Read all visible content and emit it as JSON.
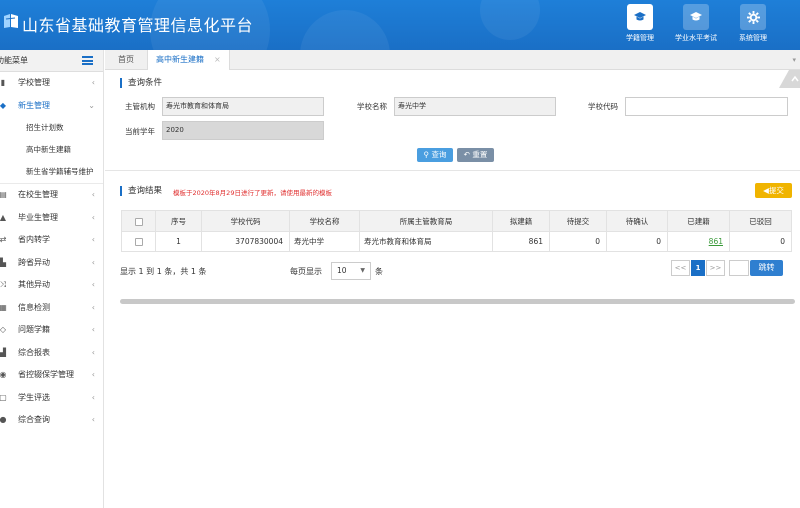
{
  "app": {
    "title": "山东省基础教育管理信息化平台"
  },
  "topnav": [
    {
      "label": "学籍管理",
      "icon": "graduation-cap-icon",
      "active": true
    },
    {
      "label": "学业水平考试",
      "icon": "graduation-cap-icon",
      "active": false
    },
    {
      "label": "系统管理",
      "icon": "gear-icon",
      "active": false
    }
  ],
  "sidebar": {
    "title": "功能菜单",
    "items": [
      {
        "label": "学校管理",
        "icon": "building-icon"
      },
      {
        "label": "新生管理",
        "icon": "user-plus-icon",
        "active": true,
        "expanded": true,
        "sub": [
          "招生计划数",
          "高中新生建籍",
          "新生省学籍辅号维护"
        ]
      },
      {
        "label": "在校生管理",
        "icon": "list-icon"
      },
      {
        "label": "毕业生管理",
        "icon": "graduation-cap-icon"
      },
      {
        "label": "省内转学",
        "icon": "exchange-icon"
      },
      {
        "label": "跨省异动",
        "icon": "map-icon"
      },
      {
        "label": "其他异动",
        "icon": "shuffle-icon"
      },
      {
        "label": "信息检测",
        "icon": "grid-icon"
      },
      {
        "label": "问题学籍",
        "icon": "question-icon"
      },
      {
        "label": "综合报表",
        "icon": "chart-icon"
      },
      {
        "label": "省控辍保学管理",
        "icon": "shield-icon"
      },
      {
        "label": "学生评选",
        "icon": "calendar-icon"
      },
      {
        "label": "综合查询",
        "icon": "search-icon"
      }
    ]
  },
  "tabs": {
    "home": "首页",
    "current": "高中新生建籍",
    "close": "×"
  },
  "query": {
    "section_title": "查询条件",
    "org_label": "主管机构",
    "org_value": "寿光市教育和体育局",
    "school_label": "学校名称",
    "school_value": "寿光中学",
    "code_label": "学校代码",
    "code_value": "",
    "year_label": "当前学年",
    "year_value": "2020",
    "search_btn": "查询",
    "reset_btn": "重置"
  },
  "results": {
    "section_title": "查询结果",
    "notice": "模板于2020年8月29日进行了更新，请使用最新的模板",
    "submit_btn": "提交",
    "columns": [
      "",
      "序号",
      "学校代码",
      "学校名称",
      "所属主管教育局",
      "拟建籍",
      "待提交",
      "待确认",
      "已建籍",
      "已驳回"
    ],
    "rows": [
      {
        "seq": "1",
        "code": "3707830004",
        "name": "寿光中学",
        "bureau": "寿光市教育和体育局",
        "planned": "861",
        "pending_submit": "0",
        "pending_confirm": "0",
        "created": "861",
        "rejected": "0"
      }
    ]
  },
  "pagination": {
    "info": "显示 1 到 1 条，共 1 条",
    "per_page_label": "每页显示",
    "per_page_value": "10",
    "per_page_unit": "条",
    "prev": "<<",
    "page": "1",
    "next": ">>",
    "jump_btn": "跳转"
  },
  "colors": {
    "brand": "#1a6fc6",
    "notice": "#e03030",
    "submit": "#f0b400"
  }
}
